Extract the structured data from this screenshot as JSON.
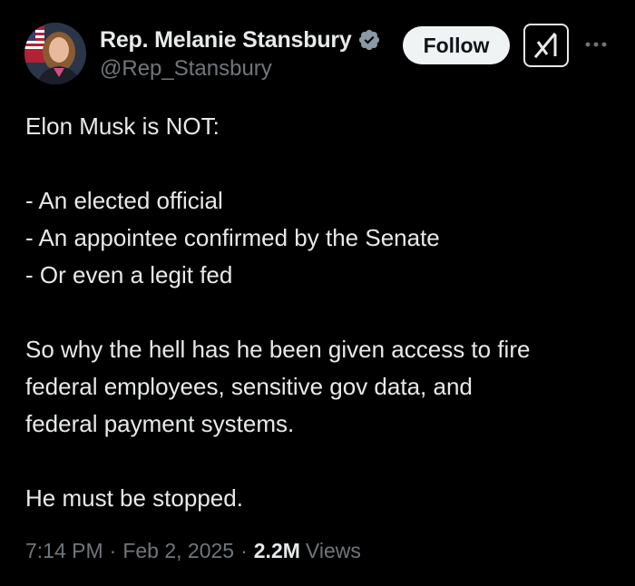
{
  "author": {
    "display_name": "Rep. Melanie Stansbury",
    "handle": "@Rep_Stansbury",
    "verified_icon": "verified-badge-icon",
    "verified_color": "#8b98a5"
  },
  "actions": {
    "follow_label": "Follow",
    "grok_icon": "grok-icon",
    "more_icon": "more-icon"
  },
  "tweet": {
    "lines": [
      "Elon Musk is NOT:",
      "",
      "- An elected official",
      "- An appointee confirmed by the Senate",
      "- Or even a legit fed",
      "",
      "So why the hell has he been given access to fire",
      "federal employees, sensitive gov data, and",
      "federal payment systems.",
      "",
      "He must be stopped."
    ]
  },
  "meta": {
    "time": "7:14 PM",
    "date": "Feb 2, 2025",
    "views_count": "2.2M",
    "views_label": "Views",
    "separator": "·"
  },
  "colors": {
    "background": "#000000",
    "text": "#e7e9ea",
    "muted": "#71767b",
    "button_bg": "#eff3f4"
  }
}
